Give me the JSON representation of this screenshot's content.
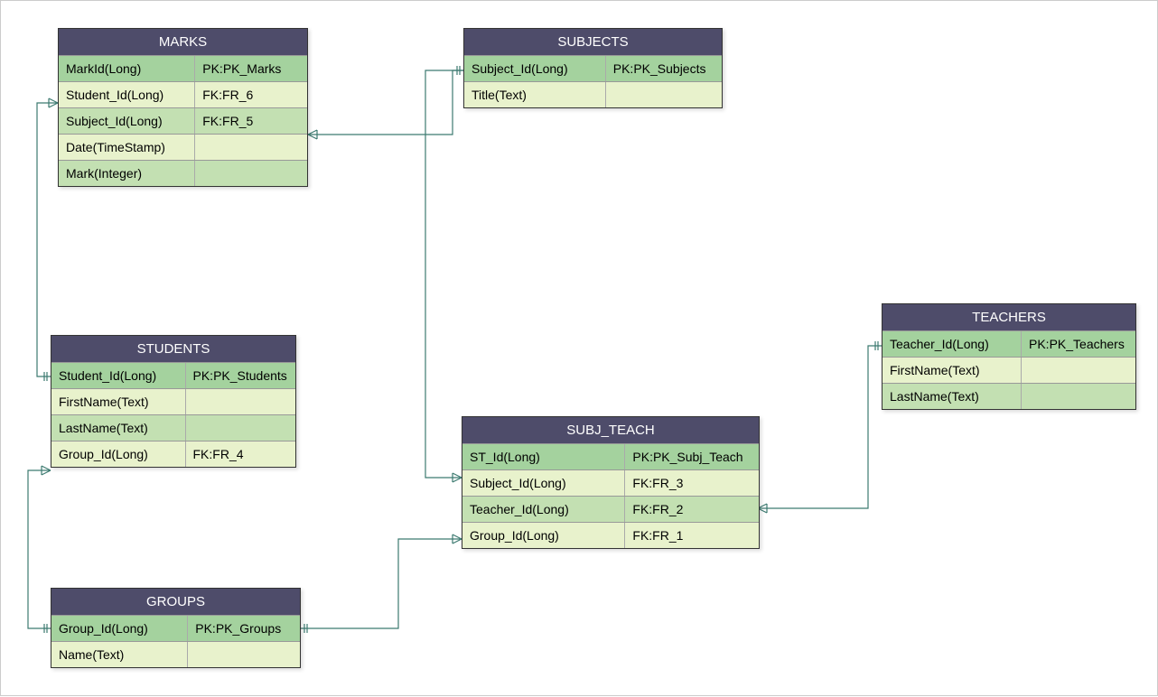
{
  "entities": {
    "marks": {
      "title": "MARKS",
      "rows": [
        {
          "left": "MarkId(Long)",
          "right": "PK:PK_Marks",
          "cls": "pk"
        },
        {
          "left": "Student_Id(Long)",
          "right": "FK:FR_6",
          "cls": "row-even"
        },
        {
          "left": "Subject_Id(Long)",
          "right": "FK:FR_5",
          "cls": "row-odd"
        },
        {
          "left": "Date(TimeStamp)",
          "right": "",
          "cls": "row-even"
        },
        {
          "left": "Mark(Integer)",
          "right": "",
          "cls": "row-odd"
        }
      ]
    },
    "students": {
      "title": "STUDENTS",
      "rows": [
        {
          "left": "Student_Id(Long)",
          "right": "PK:PK_Students",
          "cls": "pk"
        },
        {
          "left": "FirstName(Text)",
          "right": "",
          "cls": "row-even"
        },
        {
          "left": "LastName(Text)",
          "right": "",
          "cls": "row-odd"
        },
        {
          "left": "Group_Id(Long)",
          "right": "FK:FR_4",
          "cls": "row-even"
        }
      ]
    },
    "groups": {
      "title": "GROUPS",
      "rows": [
        {
          "left": "Group_Id(Long)",
          "right": "PK:PK_Groups",
          "cls": "pk"
        },
        {
          "left": "Name(Text)",
          "right": "",
          "cls": "row-even"
        }
      ]
    },
    "subjects": {
      "title": "SUBJECTS",
      "rows": [
        {
          "left": "Subject_Id(Long)",
          "right": "PK:PK_Subjects",
          "cls": "pk"
        },
        {
          "left": "Title(Text)",
          "right": "",
          "cls": "row-even"
        }
      ]
    },
    "subj_teach": {
      "title": "SUBJ_TEACH",
      "rows": [
        {
          "left": "ST_Id(Long)",
          "right": "PK:PK_Subj_Teach",
          "cls": "pk"
        },
        {
          "left": "Subject_Id(Long)",
          "right": "FK:FR_3",
          "cls": "row-even"
        },
        {
          "left": "Teacher_Id(Long)",
          "right": "FK:FR_2",
          "cls": "row-odd"
        },
        {
          "left": "Group_Id(Long)",
          "right": "FK:FR_1",
          "cls": "row-even"
        }
      ]
    },
    "teachers": {
      "title": "TEACHERS",
      "rows": [
        {
          "left": "Teacher_Id(Long)",
          "right": "PK:PK_Teachers",
          "cls": "pk"
        },
        {
          "left": "FirstName(Text)",
          "right": "",
          "cls": "row-even"
        },
        {
          "left": "LastName(Text)",
          "right": "",
          "cls": "row-odd"
        }
      ]
    }
  }
}
